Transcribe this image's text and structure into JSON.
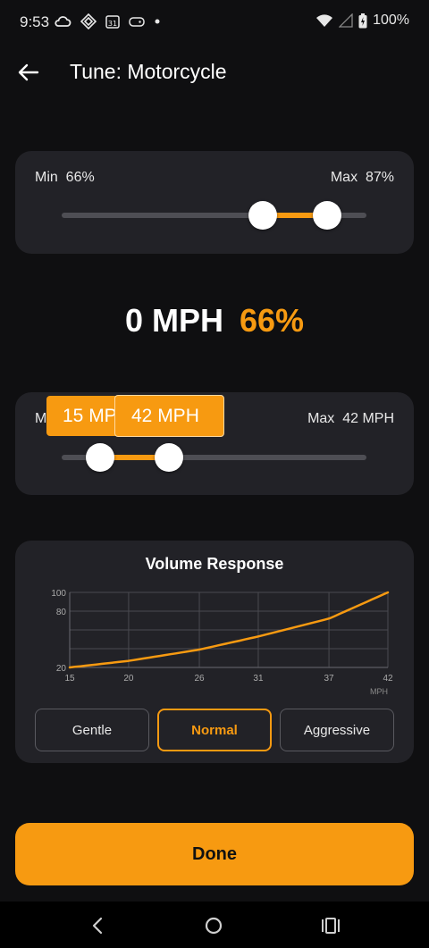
{
  "status_bar": {
    "time": "9:53",
    "battery": "100%"
  },
  "app_bar": {
    "title": "Tune: Motorcycle"
  },
  "volume_range": {
    "min_label": "Min",
    "min_value": "66%",
    "max_label": "Max",
    "max_value": "87%",
    "min_fraction": 0.66,
    "max_fraction": 0.87
  },
  "readout": {
    "speed": "0 MPH",
    "volume": "66%"
  },
  "speed_range": {
    "min_label": "Min",
    "max_label": "Max",
    "max_value": "42 MPH",
    "tooltip_min": "15 MPH",
    "tooltip_max": "42 MPH",
    "min_fraction": 0.15,
    "max_fraction": 0.42
  },
  "volume_response": {
    "title": "Volume Response",
    "buttons": [
      "Gentle",
      "Normal",
      "Aggressive"
    ],
    "selected": "Normal"
  },
  "chart_data": {
    "type": "line",
    "title": "Volume Response",
    "xlabel": "MPH",
    "ylabel": "",
    "xlim": [
      15,
      42
    ],
    "ylim": [
      20,
      100
    ],
    "x_ticks": [
      "15",
      "20",
      "26",
      "31",
      "37",
      "42"
    ],
    "y_ticks": [
      "20",
      "80",
      "100"
    ],
    "grid": true,
    "series": [
      {
        "color": "#f79a11",
        "x": [
          15,
          20,
          26,
          31,
          37,
          42
        ],
        "y": [
          20,
          27,
          39,
          53,
          72,
          100
        ]
      }
    ]
  },
  "done_button": {
    "label": "Done"
  },
  "colors": {
    "accent": "#f79a11",
    "background": "#0f0f11",
    "card": "#222227"
  }
}
